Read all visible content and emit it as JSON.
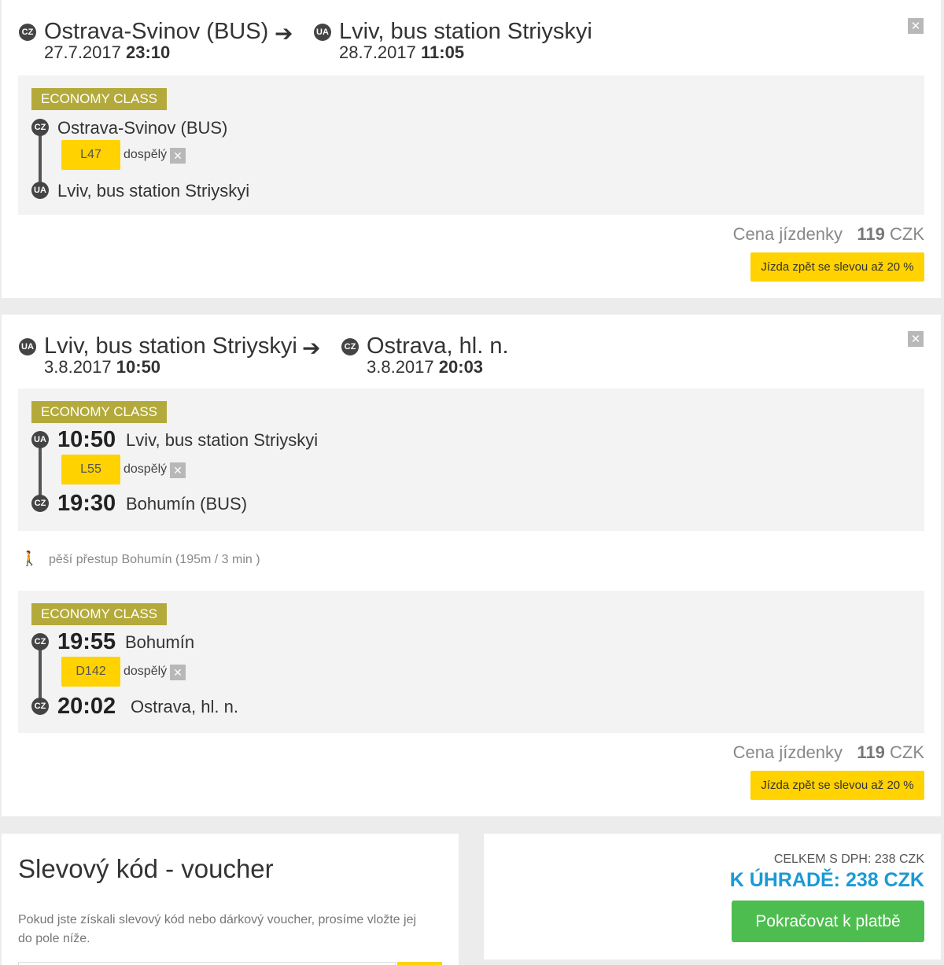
{
  "trip1": {
    "from": {
      "country": "CZ",
      "name": "Ostrava-Svinov (BUS)",
      "date": "27.7.2017",
      "time": "23:10"
    },
    "to": {
      "country": "UA",
      "name": "Lviv, bus station Striyskyi",
      "date": "28.7.2017",
      "time": "11:05"
    },
    "arrow": "➔",
    "close": "✕",
    "segments": [
      {
        "class_label": "ECONOMY CLASS",
        "departure": {
          "country": "CZ",
          "time": "",
          "name": "Ostrava-Svinov (BUS)"
        },
        "arrival": {
          "country": "UA",
          "time": "",
          "name": "Lviv, bus station Striyskyi"
        },
        "seat": "L47",
        "passenger": "dospělý",
        "remove": "✕"
      }
    ],
    "price_label": "Cena jízdenky",
    "price_value": "119",
    "price_currency": "CZK",
    "return_button": "Jízda zpět se slevou až 20 %"
  },
  "trip2": {
    "from": {
      "country": "UA",
      "name": "Lviv, bus station Striyskyi",
      "date": "3.8.2017",
      "time": "10:50"
    },
    "to": {
      "country": "CZ",
      "name": "Ostrava, hl. n.",
      "date": "3.8.2017",
      "time": "20:03"
    },
    "arrow": "➔",
    "close": "✕",
    "segments": [
      {
        "class_label": "ECONOMY CLASS",
        "departure": {
          "country": "UA",
          "time": "10:50",
          "name": "Lviv, bus station Striyskyi"
        },
        "arrival": {
          "country": "CZ",
          "time": "19:30",
          "name": "Bohumín (BUS)"
        },
        "seat": "L55",
        "passenger": "dospělý",
        "remove": "✕"
      },
      {
        "class_label": "ECONOMY CLASS",
        "departure": {
          "country": "CZ",
          "time": "19:55",
          "name": "Bohumín"
        },
        "arrival": {
          "country": "CZ",
          "time": "20:02",
          "name": "Ostrava, hl. n."
        },
        "seat": "D142",
        "passenger": "dospělý",
        "remove": "✕"
      }
    ],
    "transfer": {
      "icon": "walking-person-icon",
      "text": "pěší přestup Bohumín (195m / 3 min )"
    },
    "price_label": "Cena jízdenky",
    "price_value": "119",
    "price_currency": "CZK",
    "return_button": "Jízda zpět se slevou až 20 %"
  },
  "voucher": {
    "title": "Slevový kód - voucher",
    "description": "Pokud jste získali slevový kód nebo dárkový voucher, prosíme vložte jej do pole níže."
  },
  "summary": {
    "total_with_vat": "CELKEM S DPH: 238 CZK",
    "to_pay": "K ÚHRADĚ: 238 CZK",
    "pay_button": "Pokračovat k platbě"
  },
  "colors": {
    "accent_yellow": "#ffd200",
    "class_tag": "#b3aa3b",
    "pay_green": "#4dbd4f",
    "to_pay_blue": "#1a9ad6"
  }
}
